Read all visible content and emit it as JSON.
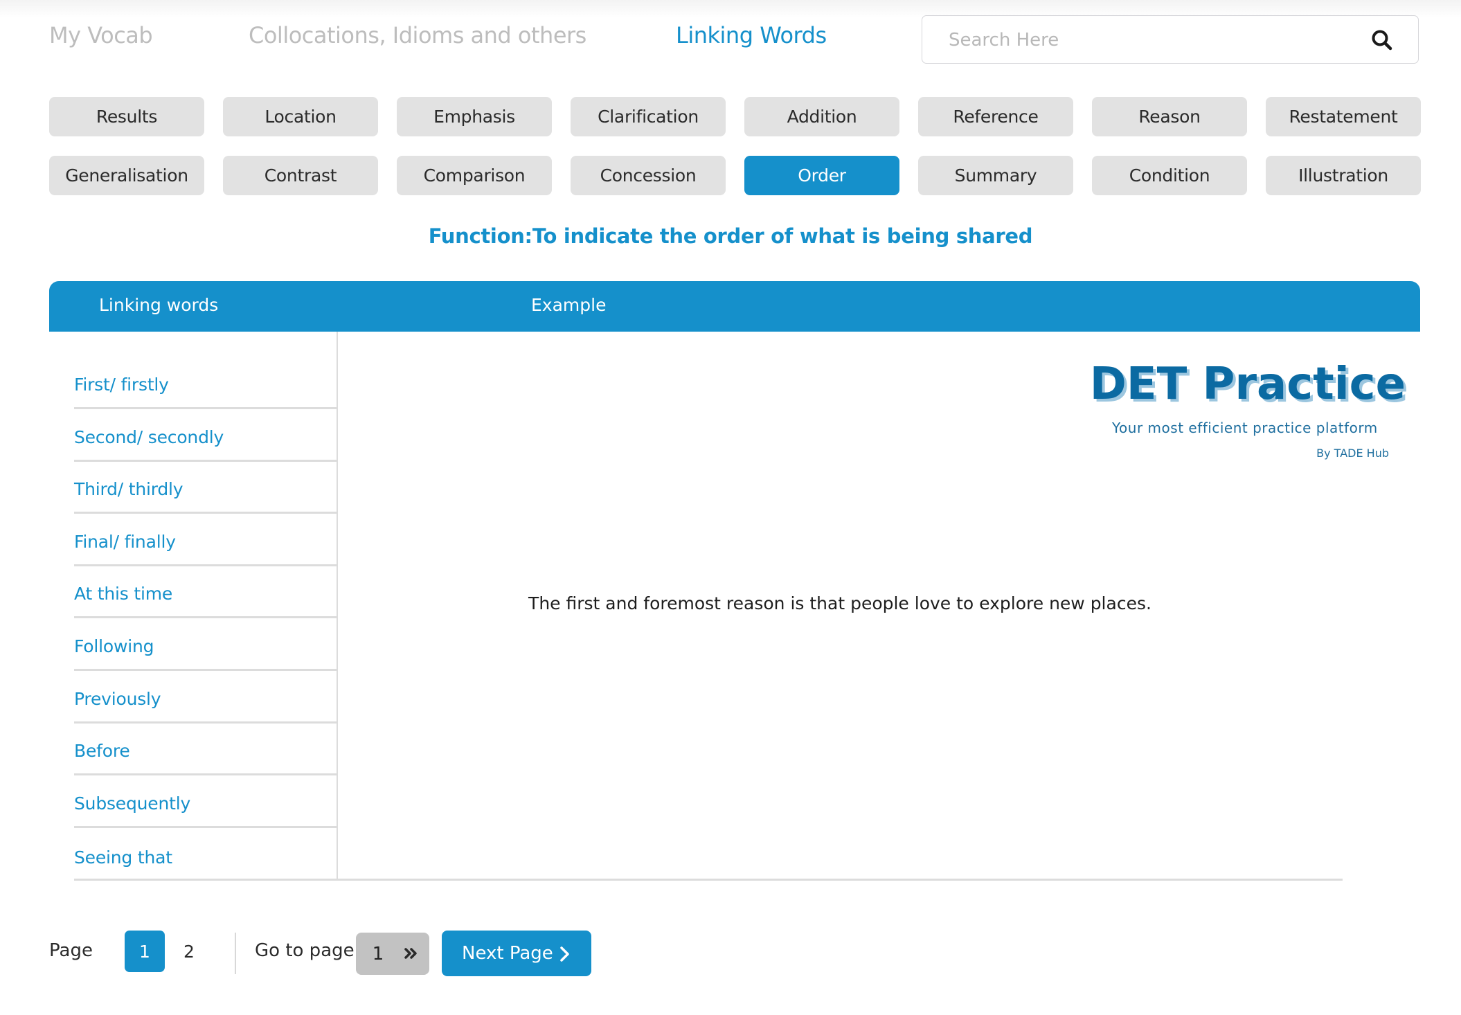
{
  "nav": {
    "tabs": [
      {
        "label": "My Vocab",
        "active": false
      },
      {
        "label": "Collocations, Idioms and others",
        "active": false
      },
      {
        "label": "Linking Words",
        "active": true
      }
    ]
  },
  "search": {
    "placeholder": "Search Here",
    "value": "",
    "icon": "search-icon"
  },
  "categories": [
    {
      "label": "Results",
      "active": false
    },
    {
      "label": "Location",
      "active": false
    },
    {
      "label": "Emphasis",
      "active": false
    },
    {
      "label": "Clarification",
      "active": false
    },
    {
      "label": "Addition",
      "active": false
    },
    {
      "label": "Reference",
      "active": false
    },
    {
      "label": "Reason",
      "active": false
    },
    {
      "label": "Restatement",
      "active": false
    },
    {
      "label": "Generalisation",
      "active": false
    },
    {
      "label": "Contrast",
      "active": false
    },
    {
      "label": "Comparison",
      "active": false
    },
    {
      "label": "Concession",
      "active": false
    },
    {
      "label": "Order",
      "active": true
    },
    {
      "label": "Summary",
      "active": false
    },
    {
      "label": "Condition",
      "active": false
    },
    {
      "label": "Illustration",
      "active": false
    }
  ],
  "function_text": "Function:To indicate the order of what is being shared",
  "table": {
    "headers": {
      "words": "Linking words",
      "example": "Example"
    },
    "words": [
      "First/ firstly",
      "Second/ secondly",
      "Third/ thirdly",
      "Final/ finally",
      "At this time",
      "Following",
      "Previously",
      "Before",
      "Subsequently",
      "Seeing that"
    ],
    "example": "The first and foremost reason is that people love to explore new places."
  },
  "logo": {
    "title": "DET Practice",
    "tagline": "Your most efficient practice platform",
    "byline": "By TADE Hub"
  },
  "pagination": {
    "page_label": "Page",
    "pages": [
      "1",
      "2"
    ],
    "current_page": "1",
    "goto_label": "Go to page",
    "goto_value": "1",
    "next_label": "Next Page"
  },
  "colors": {
    "accent": "#1590cb",
    "button_bg": "#e2e2e2",
    "goto_bg": "#c2c2c2",
    "inactive_tab": "#bdbdbd",
    "logo": "#0b6aa2"
  }
}
